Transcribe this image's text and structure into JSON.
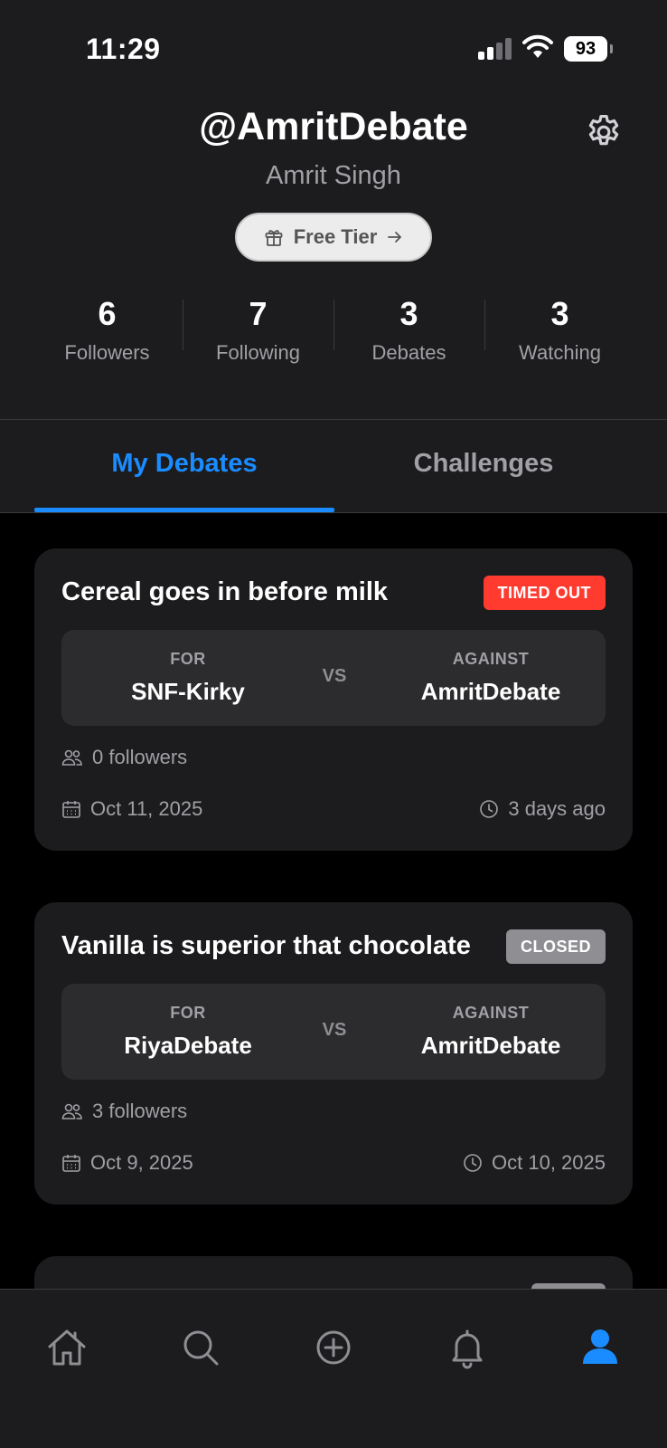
{
  "status_bar": {
    "time": "11:29",
    "battery": "93"
  },
  "profile": {
    "handle": "@AmritDebate",
    "full_name": "Amrit Singh",
    "tier_label": "Free Tier",
    "stats": [
      {
        "value": "6",
        "label": "Followers"
      },
      {
        "value": "7",
        "label": "Following"
      },
      {
        "value": "3",
        "label": "Debates"
      },
      {
        "value": "3",
        "label": "Watching"
      }
    ]
  },
  "tabs": [
    {
      "label": "My Debates",
      "active": true
    },
    {
      "label": "Challenges",
      "active": false
    }
  ],
  "debates": [
    {
      "title": "Cereal goes in before milk",
      "status": "TIMED OUT",
      "status_color": "#ff3b30",
      "for_label": "FOR",
      "for_user": "SNF-Kirky",
      "vs_label": "VS",
      "against_label": "AGAINST",
      "against_user": "AmritDebate",
      "followers": "0 followers",
      "date": "Oct 11, 2025",
      "time_ago": "3 days ago"
    },
    {
      "title": "Vanilla is superior that chocolate",
      "status": "CLOSED",
      "status_color": "#8e8e93",
      "for_label": "FOR",
      "for_user": "RiyaDebate",
      "vs_label": "VS",
      "against_label": "AGAINST",
      "against_user": "AmritDebate",
      "followers": "3 followers",
      "date": "Oct 9, 2025",
      "time_ago": "Oct 10, 2025"
    }
  ],
  "nav": [
    "home-icon",
    "search-icon",
    "create-icon",
    "bell-icon",
    "profile-icon"
  ],
  "colors": {
    "accent": "#1a8cff",
    "background": "#000000",
    "surface": "#1c1c1e"
  }
}
